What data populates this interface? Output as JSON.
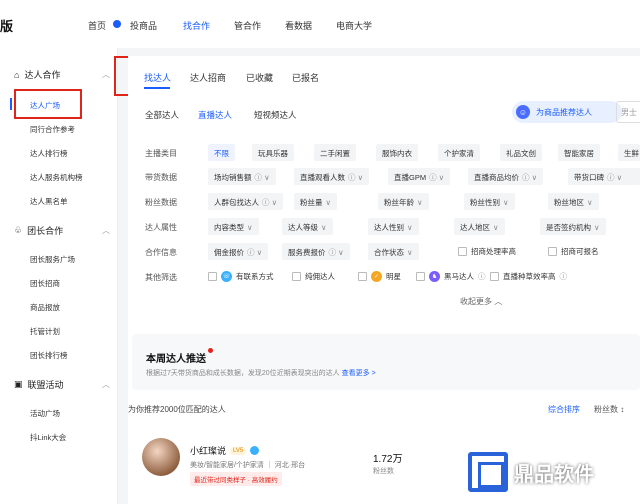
{
  "topnav": {
    "logo_fragment": "版",
    "items": [
      "首页",
      "投商品",
      "找合作",
      "管合作",
      "看数据",
      "电商大学"
    ],
    "active_index": 2
  },
  "sidebar": {
    "sections": [
      {
        "label": "达人合作",
        "icon": "home-icon",
        "items": [
          "达人广场",
          "同行合作参考",
          "达人排行榜",
          "达人服务机构榜",
          "达人黑名单"
        ]
      },
      {
        "label": "团长合作",
        "icon": "group-icon",
        "items": [
          "团长服务广场",
          "团长招商",
          "商品报放",
          "托管计划",
          "团长排行榜"
        ]
      },
      {
        "label": "联盟活动",
        "icon": "calendar-icon",
        "items": [
          "活动广场",
          "抖Link大会"
        ]
      }
    ]
  },
  "main": {
    "tabs": [
      "找达人",
      "达人招商",
      "已收藏",
      "已报名"
    ],
    "subtabs": [
      "全部达人",
      "直播达人",
      "短视频达人"
    ],
    "recommend_button": "为商品推荐达人",
    "search_placeholder": "男士",
    "filters": {
      "主播类目": [
        "不限",
        "玩具乐器",
        "二手闲置",
        "服饰内衣",
        "个护家清",
        "礼品文创",
        "智能家居",
        "生鲜"
      ],
      "带货数据": [
        "场均销售额",
        "直播观看人数",
        "直播GPM",
        "直播商品均价",
        "带货口碑"
      ],
      "粉丝数据": [
        "人群包找达人",
        "粉丝量",
        "粉丝年龄",
        "粉丝性别",
        "粉丝地区"
      ],
      "达人属性": [
        "内容类型",
        "达人等级",
        "达人性别",
        "达人地区",
        "是否签约机构"
      ],
      "合作信息": [
        "佣金报价",
        "服务费报价",
        "合作状态",
        "招商处理率高",
        "招商可报名"
      ],
      "其他筛选": [
        "有联系方式",
        "纯佣达人",
        "明星",
        "黑马达人",
        "直播种草效率高"
      ]
    },
    "collapse_label": "收起更多 ︿",
    "weekly": {
      "title": "本周达人推送",
      "desc": "根据过7天带货商品和成长数据，发现20位近期表现突出的达人",
      "link": "查看更多 >"
    },
    "count_text": "为你推荐2000位匹配的达人",
    "sort": [
      "综合排序",
      "粉丝数 ↕"
    ],
    "creator": {
      "name": "小红璨说",
      "level": "LV5",
      "meta": "美妆/智能家居/个护家清 ｜ 河北·邢台",
      "tag": "最近带过同类样子 · 高效履约",
      "fans_value": "1.72万",
      "fans_label": "粉丝数"
    }
  },
  "watermark": "鼎品软件",
  "colors": {
    "accent": "#1a5cff",
    "highlight": "#e2231a"
  }
}
